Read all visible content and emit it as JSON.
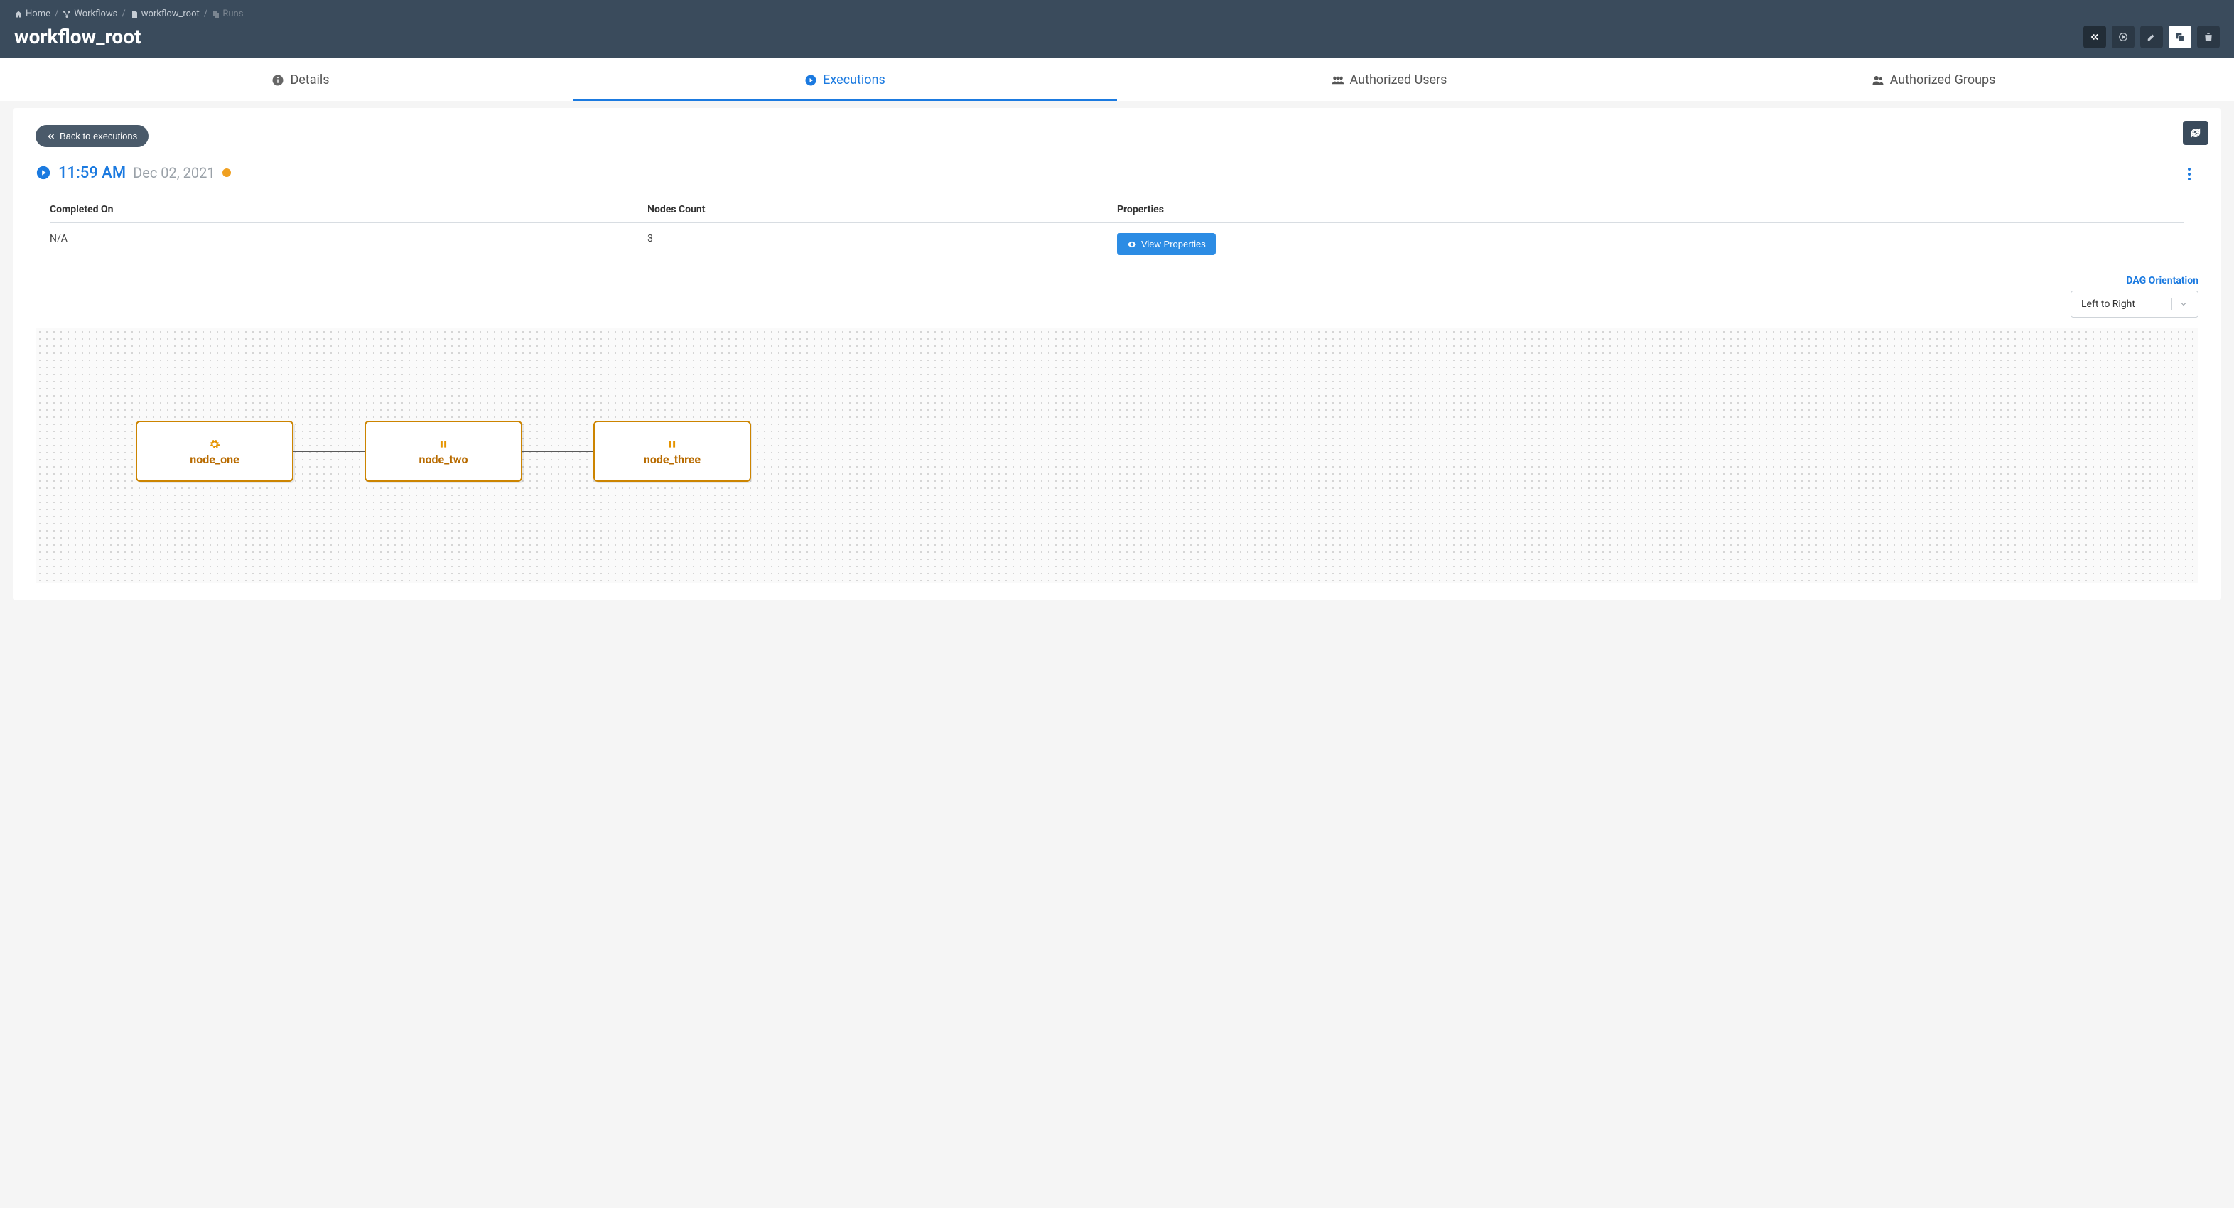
{
  "breadcrumb": {
    "home": "Home",
    "workflows": "Workflows",
    "workflow": "workflow_root",
    "runs": "Runs"
  },
  "page_title": "workflow_root",
  "tabs": {
    "details": "Details",
    "executions": "Executions",
    "auth_users": "Authorized Users",
    "auth_groups": "Authorized Groups"
  },
  "back_button": "Back to executions",
  "run": {
    "time": "11:59 AM",
    "date": "Dec 02, 2021",
    "status_color": "#f0a020"
  },
  "info": {
    "col_completed": "Completed On",
    "col_nodes": "Nodes Count",
    "col_props": "Properties",
    "completed_value": "N/A",
    "nodes_value": "3",
    "view_props_btn": "View Properties"
  },
  "dag": {
    "label": "DAG Orientation",
    "selected": "Left to Right",
    "nodes": [
      {
        "name": "node_one",
        "icon": "gear"
      },
      {
        "name": "node_two",
        "icon": "pause"
      },
      {
        "name": "node_three",
        "icon": "pause"
      }
    ]
  }
}
